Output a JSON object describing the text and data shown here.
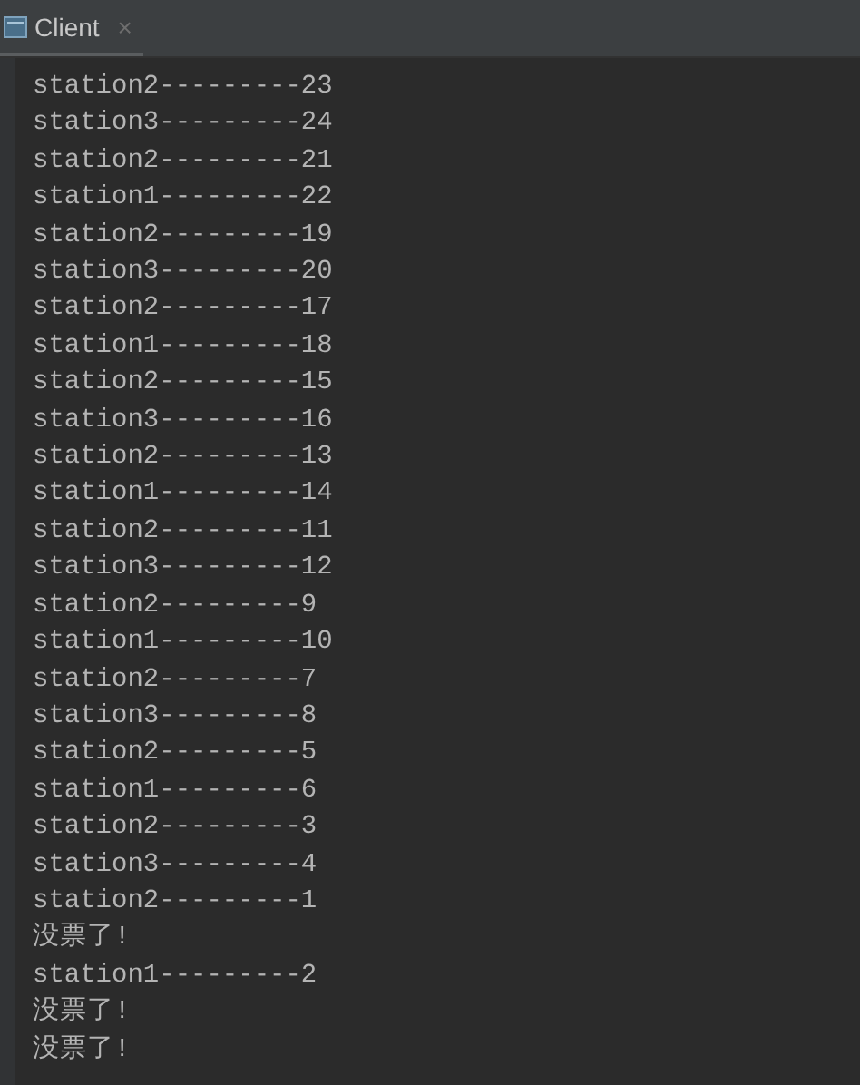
{
  "tab": {
    "title": "Client",
    "close": "×",
    "selected": true
  },
  "console_lines": [
    "station2---------23",
    "station3---------24",
    "station2---------21",
    "station1---------22",
    "station2---------19",
    "station3---------20",
    "station2---------17",
    "station1---------18",
    "station2---------15",
    "station3---------16",
    "station2---------13",
    "station1---------14",
    "station2---------11",
    "station3---------12",
    "station2---------9",
    "station1---------10",
    "station2---------7",
    "station3---------8",
    "station2---------5",
    "station1---------6",
    "station2---------3",
    "station3---------4",
    "station2---------1",
    "没票了!",
    "station1---------2",
    "没票了!",
    "没票了!"
  ]
}
